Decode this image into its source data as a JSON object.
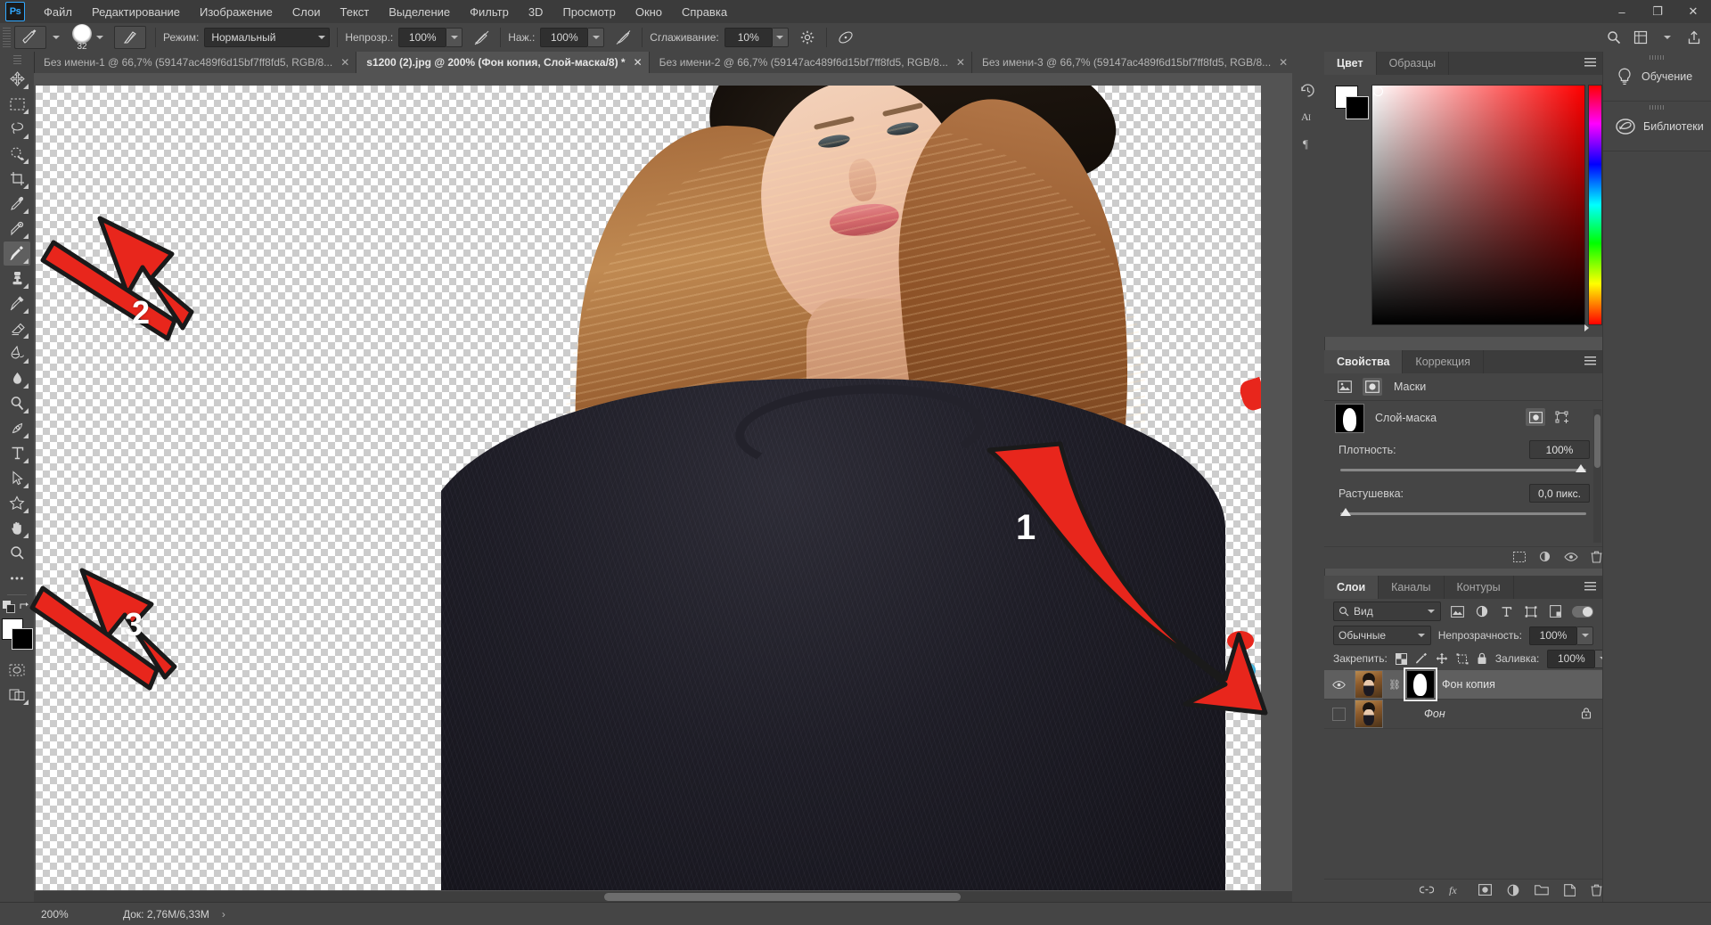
{
  "app": {
    "name": "Adobe Photoshop",
    "logo_text": "Ps"
  },
  "menubar": {
    "items": [
      {
        "label": "Файл"
      },
      {
        "label": "Редактирование"
      },
      {
        "label": "Изображение"
      },
      {
        "label": "Слои"
      },
      {
        "label": "Текст"
      },
      {
        "label": "Выделение"
      },
      {
        "label": "Фильтр"
      },
      {
        "label": "3D"
      },
      {
        "label": "Просмотр"
      },
      {
        "label": "Окно"
      },
      {
        "label": "Справка"
      }
    ],
    "window_controls": {
      "minimize": "–",
      "maximize": "❐",
      "close": "✕"
    }
  },
  "options_bar": {
    "brush_size": "32",
    "mode_label": "Режим:",
    "mode_value": "Нормальный",
    "opacity_label": "Непрозр.:",
    "opacity_value": "100%",
    "flow_label": "Наж.:",
    "flow_value": "100%",
    "smoothing_label": "Сглаживание:",
    "smoothing_value": "10%"
  },
  "document_tabs": [
    {
      "title": "Без имени-1 @ 66,7% (59147ac489f6d15bf7ff8fd5, RGB/8...",
      "active": false,
      "close": "✕"
    },
    {
      "title": "s1200 (2).jpg @ 200% (Фон копия, Слой-маска/8) *",
      "active": true,
      "close": "✕"
    },
    {
      "title": "Без имени-2 @ 66,7% (59147ac489f6d15bf7ff8fd5, RGB/8...",
      "active": false,
      "close": "✕"
    },
    {
      "title": "Без имени-3 @ 66,7% (59147ac489f6d15bf7ff8fd5, RGB/8...",
      "active": false,
      "close": "✕"
    }
  ],
  "toolbar": {
    "tools": [
      {
        "name": "move-tool"
      },
      {
        "name": "rectangular-marquee-tool"
      },
      {
        "name": "lasso-tool"
      },
      {
        "name": "quick-selection-tool"
      },
      {
        "name": "crop-tool"
      },
      {
        "name": "eyedropper-tool"
      },
      {
        "name": "spot-healing-brush-tool"
      },
      {
        "name": "brush-tool",
        "selected": true
      },
      {
        "name": "clone-stamp-tool"
      },
      {
        "name": "history-brush-tool"
      },
      {
        "name": "eraser-tool"
      },
      {
        "name": "gradient-tool"
      },
      {
        "name": "blur-tool"
      },
      {
        "name": "dodge-tool"
      },
      {
        "name": "pen-tool"
      },
      {
        "name": "horizontal-type-tool"
      },
      {
        "name": "path-selection-tool"
      },
      {
        "name": "custom-shape-tool"
      },
      {
        "name": "hand-tool"
      },
      {
        "name": "zoom-tool"
      },
      {
        "name": "edit-toolbar-tool"
      }
    ],
    "foreground_color": "#ffffff",
    "background_color": "#000000"
  },
  "annotations": [
    {
      "number": "1",
      "desc": "arrow pointing to layer mask thumbnail"
    },
    {
      "number": "2",
      "desc": "arrow pointing to brush tool"
    },
    {
      "number": "3",
      "desc": "arrow pointing to foreground/background color swatches"
    }
  ],
  "color_panel": {
    "tabs": [
      {
        "label": "Цвет",
        "active": true
      },
      {
        "label": "Образцы",
        "active": false
      }
    ],
    "foreground": "#ffffff",
    "background": "#000000",
    "hue": "#ff0000"
  },
  "properties_panel": {
    "tabs": [
      {
        "label": "Свойства",
        "active": true
      },
      {
        "label": "Коррекция",
        "active": false
      }
    ],
    "section_label": "Маски",
    "mask_name": "Слой-маска",
    "density_label": "Плотность:",
    "density_value": "100%",
    "feather_label": "Растушевка:",
    "feather_value": "0,0 пикс."
  },
  "layers_panel": {
    "tabs": [
      {
        "label": "Слои",
        "active": true
      },
      {
        "label": "Каналы",
        "active": false
      },
      {
        "label": "Контуры",
        "active": false
      }
    ],
    "filter_value": "Вид",
    "blend_mode": "Обычные",
    "opacity_label": "Непрозрачность:",
    "opacity_value": "100%",
    "lock_label": "Закрепить:",
    "fill_label": "Заливка:",
    "fill_value": "100%",
    "layers": [
      {
        "name": "Фон копия",
        "selected": true,
        "locked": false,
        "has_mask": true,
        "visible": true
      },
      {
        "name": "Фон",
        "selected": false,
        "locked": true,
        "has_mask": false,
        "visible": false,
        "italic": true
      }
    ]
  },
  "right_rail": {
    "items": [
      {
        "label": "Обучение",
        "icon": "lightbulb-icon"
      },
      {
        "label": "Библиотеки",
        "icon": "creative-cloud-libraries-icon"
      }
    ]
  },
  "status_bar": {
    "zoom": "200%",
    "doc_info": "Док: 2,76M/6,33M",
    "arrow": "›"
  },
  "colors": {
    "chrome_bg": "#454545",
    "menu_bg": "#3b3b3b",
    "canvas_bg": "#535353",
    "accent": "#31a8ff",
    "annotation_red": "#e8261c",
    "text": "#c8c8c8"
  }
}
